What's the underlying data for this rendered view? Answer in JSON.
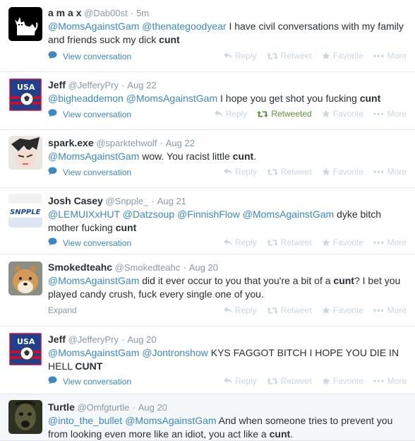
{
  "labels": {
    "view_conversation": "View conversation",
    "expand": "Expand",
    "reply": "Reply",
    "retweet": "Retweet",
    "retweeted": "Retweeted",
    "favorite": "Favorite",
    "more": "More",
    "separator": "·"
  },
  "colors": {
    "link": "#3b88c3",
    "muted": "#8899a6",
    "action_inactive": "#ccd6dd",
    "retweeted": "#5c913b",
    "divider": "#e1e8ed"
  },
  "tweets": [
    {
      "name": "a m a x",
      "handle": "@Dab00st",
      "time": "5m",
      "avatar": "cat-pixel-avatar",
      "segments": [
        {
          "t": "m",
          "v": "@MomsAgainstGam"
        },
        {
          "t": "t",
          "v": " "
        },
        {
          "t": "m",
          "v": "@thenategoodyear"
        },
        {
          "t": "t",
          "v": " I have civil conversations with my family and friends suck my dick "
        },
        {
          "t": "b",
          "v": "cunt"
        }
      ],
      "footer": "view",
      "retweeted": false
    },
    {
      "name": "Jeff",
      "handle": "@JefferyPry",
      "time": "Aug 22",
      "avatar": "usa-soccer-avatar",
      "segments": [
        {
          "t": "m",
          "v": "@bigheaddemon"
        },
        {
          "t": "t",
          "v": " "
        },
        {
          "t": "m",
          "v": "@MomsAgainstGam"
        },
        {
          "t": "t",
          "v": " I hope you get shot you fucking "
        },
        {
          "t": "b",
          "v": "cunt"
        }
      ],
      "footer": "view",
      "retweeted": true
    },
    {
      "name": "spark.exe",
      "handle": "@sparktehwolf",
      "time": "Aug 22",
      "avatar": "anime-avatar",
      "segments": [
        {
          "t": "m",
          "v": "@MomsAgainstGam"
        },
        {
          "t": "t",
          "v": " wow. You racist little "
        },
        {
          "t": "b",
          "v": "cunt"
        },
        {
          "t": "t",
          "v": "."
        }
      ],
      "footer": "view",
      "retweeted": false
    },
    {
      "name": "Josh Casey",
      "handle": "@Snpple_",
      "time": "Aug 21",
      "avatar": "snpple-avatar",
      "avatar_text": "SNPPLE",
      "segments": [
        {
          "t": "m",
          "v": "@LEMUIXxHUT"
        },
        {
          "t": "t",
          "v": " "
        },
        {
          "t": "m",
          "v": "@Datzsoup"
        },
        {
          "t": "t",
          "v": " "
        },
        {
          "t": "m",
          "v": "@FinnishFlow"
        },
        {
          "t": "t",
          "v": " "
        },
        {
          "t": "m",
          "v": "@MomsAgainstGam"
        },
        {
          "t": "t",
          "v": " dyke bitch mother fucking "
        },
        {
          "t": "b",
          "v": "cunt"
        }
      ],
      "footer": "view",
      "retweeted": false
    },
    {
      "name": "Smokedteahc",
      "handle": "@Smokedteahc",
      "time": "Aug 20",
      "avatar": "shiba-dog-avatar",
      "segments": [
        {
          "t": "m",
          "v": "@MomsAgainstGam"
        },
        {
          "t": "t",
          "v": " did it ever occur to you that you're a bit of a "
        },
        {
          "t": "b",
          "v": "cunt"
        },
        {
          "t": "t",
          "v": "? I bet you played candy crush, fuck every single one of you."
        }
      ],
      "footer": "expand",
      "retweeted": false
    },
    {
      "name": "Jeff",
      "handle": "@JefferyPry",
      "time": "Aug 20",
      "avatar": "usa-soccer-avatar",
      "segments": [
        {
          "t": "m",
          "v": "@MomsAgainstGam"
        },
        {
          "t": "t",
          "v": " "
        },
        {
          "t": "m",
          "v": "@Jontronshow"
        },
        {
          "t": "t",
          "v": " KYS FAGGOT BITCH I HOPE YOU DIE IN HELL "
        },
        {
          "t": "b",
          "v": "CUNT"
        }
      ],
      "footer": "view",
      "retweeted": false
    },
    {
      "name": "Turtle",
      "handle": "@Omfgturtle",
      "time": "Aug 20",
      "avatar": "dark-face-avatar",
      "segments": [
        {
          "t": "m",
          "v": "@into_the_bullet"
        },
        {
          "t": "t",
          "v": " "
        },
        {
          "t": "m",
          "v": "@MomsAgainstGam"
        },
        {
          "t": "t",
          "v": " And when someone tries to prevent you from looking even more like an idiot, you act like a "
        },
        {
          "t": "b",
          "v": "cunt"
        },
        {
          "t": "t",
          "v": "."
        }
      ],
      "footer": "none",
      "retweeted": false
    }
  ]
}
